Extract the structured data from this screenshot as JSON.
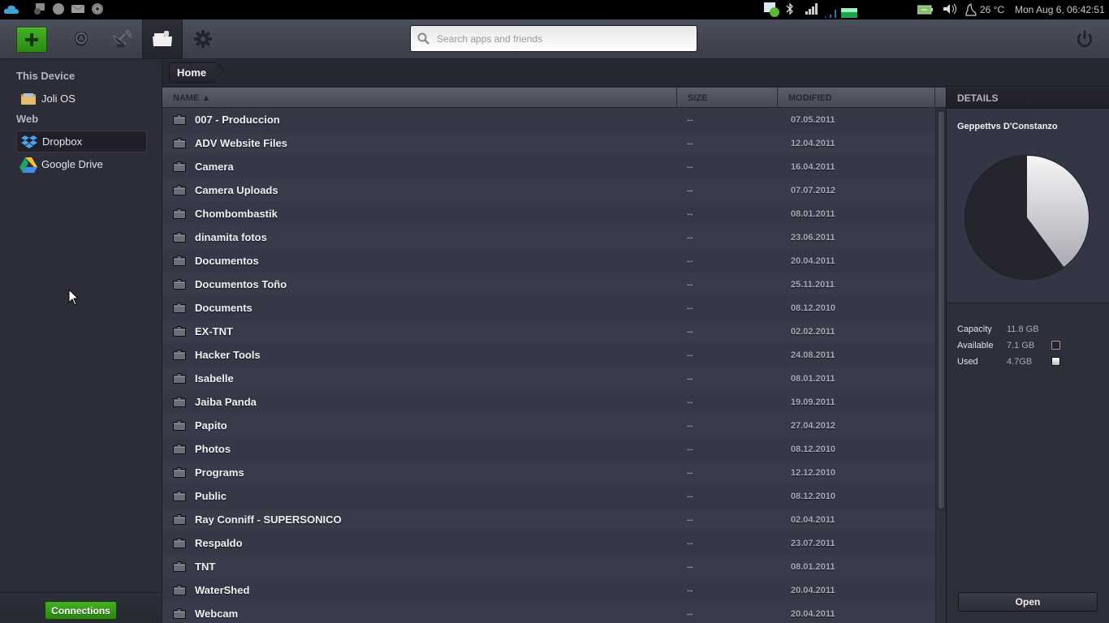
{
  "system_bar": {
    "left_icons": [
      "cloud-icon",
      "chat-icon",
      "status-circle-icon",
      "mail-icon",
      "chrome-icon"
    ],
    "right_icons": [
      "messaging-icon",
      "bluetooth-icon",
      "signal-icon",
      "network-activity-icon",
      "battery-icon",
      "volume-icon",
      "weather-icon"
    ],
    "temperature": "26 °C",
    "datetime": "Mon Aug  6, 06:42:51"
  },
  "toolbar": {
    "add_button": "add-app",
    "buttons": [
      "app-store",
      "network",
      "files",
      "settings"
    ],
    "search_placeholder": "Search apps and friends",
    "search_value": ""
  },
  "sidebar": {
    "sections": [
      {
        "heading": "This Device",
        "items": [
          {
            "label": "Joli OS",
            "icon": "folder-icon",
            "active": false
          }
        ]
      },
      {
        "heading": "Web",
        "items": [
          {
            "label": "Dropbox",
            "icon": "dropbox-icon",
            "active": true
          },
          {
            "label": "Google Drive",
            "icon": "google-drive-icon",
            "active": false
          }
        ]
      }
    ],
    "connections_button": "Connections"
  },
  "breadcrumb": {
    "items": [
      "Home"
    ]
  },
  "table": {
    "columns": [
      {
        "label": "NAME ▲",
        "sorted": "asc"
      },
      {
        "label": "SIZE"
      },
      {
        "label": "MODIFIED"
      }
    ],
    "rows": [
      {
        "name": "007 - Produccion",
        "size": "--",
        "modified": "07.05.2011"
      },
      {
        "name": "ADV Website Files",
        "size": "--",
        "modified": "12.04.2011"
      },
      {
        "name": "Camera",
        "size": "--",
        "modified": "16.04.2011"
      },
      {
        "name": "Camera Uploads",
        "size": "--",
        "modified": "07.07.2012"
      },
      {
        "name": "Chombombastik",
        "size": "--",
        "modified": "08.01.2011"
      },
      {
        "name": "dinamita fotos",
        "size": "--",
        "modified": "23.06.2011"
      },
      {
        "name": "Documentos",
        "size": "--",
        "modified": "20.04.2011"
      },
      {
        "name": "Documentos Toño",
        "size": "--",
        "modified": "25.11.2011"
      },
      {
        "name": "Documents",
        "size": "--",
        "modified": "08.12.2010"
      },
      {
        "name": "EX-TNT",
        "size": "--",
        "modified": "02.02.2011"
      },
      {
        "name": "Hacker Tools",
        "size": "--",
        "modified": "24.08.2011"
      },
      {
        "name": "Isabelle",
        "size": "--",
        "modified": "08.01.2011"
      },
      {
        "name": "Jaiba Panda",
        "size": "--",
        "modified": "19.09.2011"
      },
      {
        "name": "Papito",
        "size": "--",
        "modified": "27.04.2012"
      },
      {
        "name": "Photos",
        "size": "--",
        "modified": "08.12.2010"
      },
      {
        "name": "Programs",
        "size": "--",
        "modified": "12.12.2010"
      },
      {
        "name": "Public",
        "size": "--",
        "modified": "08.12.2010"
      },
      {
        "name": "Ray Conniff - SUPERSONICO",
        "size": "--",
        "modified": "02.04.2011"
      },
      {
        "name": "Respaldo",
        "size": "--",
        "modified": "23.07.2011"
      },
      {
        "name": "TNT",
        "size": "--",
        "modified": "08.01.2011"
      },
      {
        "name": "WaterShed",
        "size": "--",
        "modified": "20.04.2011"
      },
      {
        "name": "Webcam",
        "size": "--",
        "modified": "20.04.2011"
      }
    ]
  },
  "details": {
    "heading": "DETAILS",
    "account_name": "Geppettvs D'Constanzo",
    "stats": [
      {
        "label": "Capacity",
        "value": "11.8 GB"
      },
      {
        "label": "Available",
        "value": "7.1 GB",
        "swatch": "#22232b"
      },
      {
        "label": "Used",
        "value": "4.7GB",
        "swatch": "#e6e6e8"
      }
    ],
    "usage": {
      "capacity_gb": 11.8,
      "available_gb": 7.1,
      "used_gb": 4.7
    },
    "open_button": "Open"
  },
  "colors": {
    "accent_green": "#3a9e1c",
    "pie_available": "#22232b",
    "pie_used": "#e6e6e8"
  }
}
